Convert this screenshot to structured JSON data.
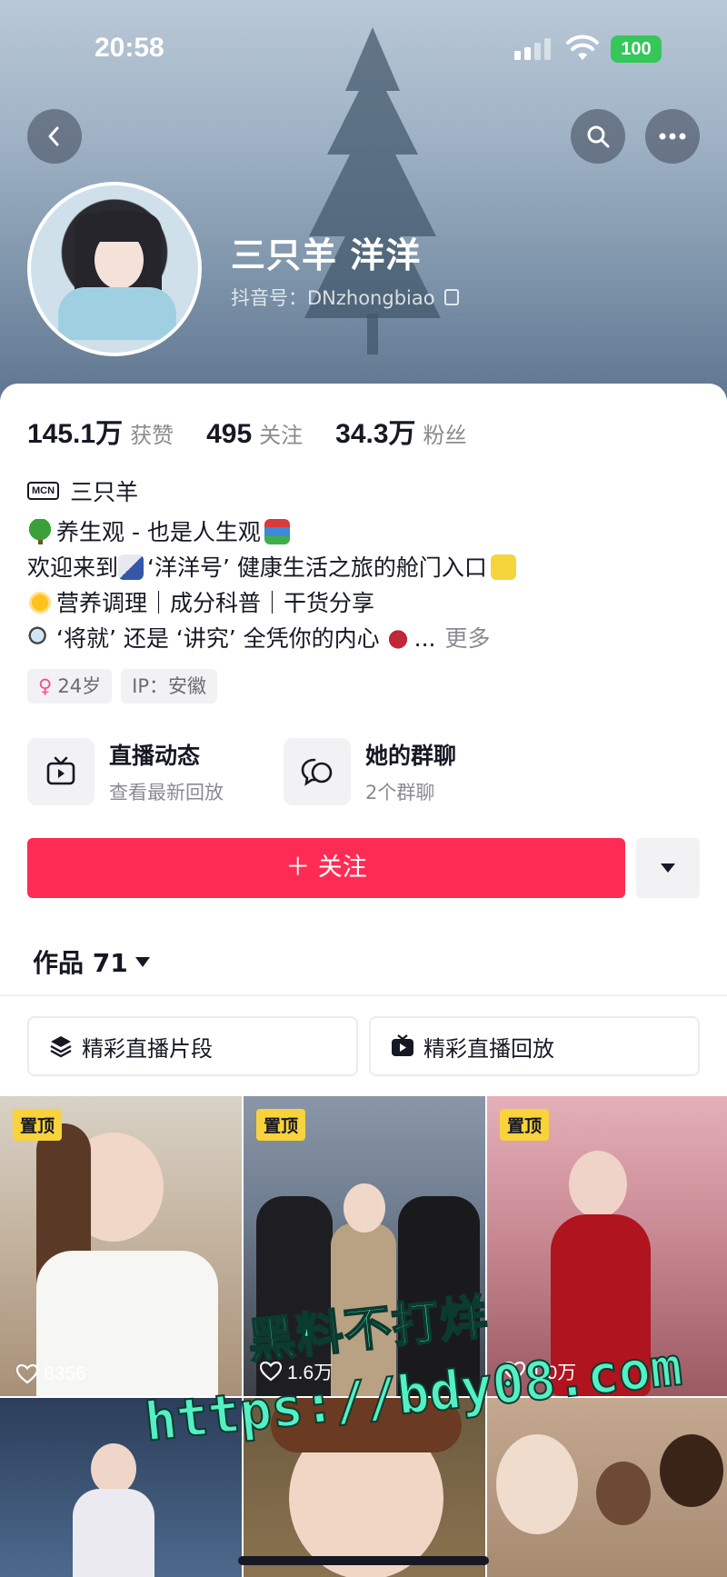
{
  "status_bar": {
    "time": "20:58",
    "battery": "100"
  },
  "profile": {
    "name": "三只羊 洋洋",
    "douyin_id": "抖音号：DNzhongbiao"
  },
  "stats": [
    {
      "num": "145.1万",
      "label": "获赞"
    },
    {
      "num": "495",
      "label": "关注"
    },
    {
      "num": "34.3万",
      "label": "粉丝"
    }
  ],
  "mcn": {
    "badge": "MCN",
    "name": "三只羊"
  },
  "bio": {
    "line1": "养生观 - 也是人生观",
    "line2": "欢迎来到",
    "line2b": "‘洋洋号’ 健康生活之旅的舱门入口",
    "line3": "营养调理｜成分科普｜干货分享",
    "line4": "‘将就’ 还是 ‘讲究’ 全凭你的内心",
    "line4_tail": "...",
    "more": "更多"
  },
  "tags": {
    "age": "24岁",
    "ip": "IP：安徽"
  },
  "features": [
    {
      "title": "直播动态",
      "sub": "查看最新回放"
    },
    {
      "title": "她的群聊",
      "sub": "2个群聊"
    }
  ],
  "actions": {
    "follow": "＋ 关注"
  },
  "works": {
    "label": "作品 71"
  },
  "segments": [
    {
      "label": "精彩直播片段"
    },
    {
      "label": "精彩直播回放"
    }
  ],
  "tiles": [
    {
      "pin": "置顶",
      "likes": "8356"
    },
    {
      "pin": "置顶",
      "likes": "1.6万"
    },
    {
      "pin": "置顶",
      "likes": "1.0万"
    }
  ],
  "watermark": {
    "line1": "黑料不打烊",
    "line2": "https://bdy08.com"
  },
  "colors": {
    "accent": "#fe2c55",
    "pin": "#f8d33c",
    "battery": "#35c759"
  }
}
